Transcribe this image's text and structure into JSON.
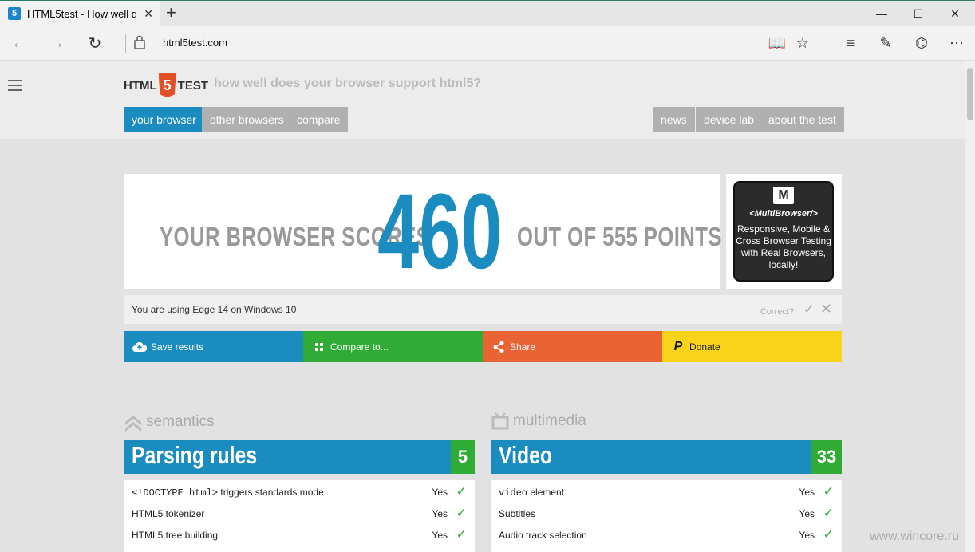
{
  "browser": {
    "tab_title": "HTML5test - How well d",
    "tab_icon": "5",
    "url": "html5test.com"
  },
  "site": {
    "logo_html": "HTML",
    "logo_num": "5",
    "logo_test": "TEST",
    "tagline": "how well does your browser support html5?",
    "nav_left": [
      "your browser",
      "other browsers",
      "compare"
    ],
    "nav_right": [
      "news",
      "device lab",
      "about the test"
    ]
  },
  "score": {
    "prefix": "YOUR BROWSER SCORES",
    "value": "460",
    "suffix": "OUT OF 555 POINTS"
  },
  "ad": {
    "brand": "<MultiBrowser/>",
    "text": "Responsive, Mobile & Cross Browser Testing with Real Browsers, locally!"
  },
  "info": {
    "text": "You are using Edge 14 on Windows 10",
    "correct": "Correct?"
  },
  "actions": {
    "save": "Save results",
    "compare": "Compare to...",
    "share": "Share",
    "donate": "Donate"
  },
  "categories": {
    "left": {
      "title": "semantics",
      "section": "Parsing rules",
      "score": "5",
      "rows": [
        {
          "code": "<!DOCTYPE html>",
          "label": " triggers standards mode",
          "value": "Yes"
        },
        {
          "code": "",
          "label": "HTML5 tokenizer",
          "value": "Yes"
        },
        {
          "code": "",
          "label": "HTML5 tree building",
          "value": "Yes"
        }
      ]
    },
    "right": {
      "title": "multimedia",
      "section": "Video",
      "score": "33",
      "rows": [
        {
          "code": "video",
          "label": " element",
          "value": "Yes"
        },
        {
          "code": "",
          "label": "Subtitles",
          "value": "Yes"
        },
        {
          "code": "",
          "label": "Audio track selection",
          "value": "Yes"
        }
      ]
    }
  },
  "watermark": "www.wincore.ru",
  "colors": {
    "blue": "#1a8cc0",
    "green": "#2fab36",
    "orange": "#ea6335",
    "yellow": "#f9d21a",
    "html5_orange": "#e34f26"
  }
}
